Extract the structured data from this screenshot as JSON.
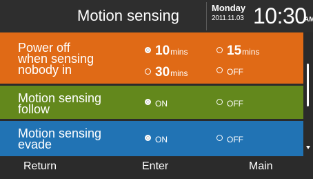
{
  "header": {
    "title": "Motion sensing",
    "day": "Monday",
    "date": "2011.11.03",
    "time": "10:30",
    "ampm": "AM"
  },
  "settings": [
    {
      "label_lines": [
        "Power off",
        "when sensing",
        "nobody in"
      ],
      "options": [
        {
          "num": "10",
          "unit": "mins",
          "selected": true
        },
        {
          "num": "15",
          "unit": "mins",
          "selected": false
        },
        {
          "num": "30",
          "unit": "mins",
          "selected": false
        },
        {
          "text": "OFF",
          "selected": false
        }
      ]
    },
    {
      "label_lines": [
        "Motion sensing",
        "follow"
      ],
      "options": [
        {
          "text": "ON",
          "selected": true
        },
        {
          "text": "OFF",
          "selected": false
        }
      ]
    },
    {
      "label_lines": [
        "Motion sensing",
        "evade"
      ],
      "options": [
        {
          "text": "ON",
          "selected": true
        },
        {
          "text": "OFF",
          "selected": false
        }
      ]
    }
  ],
  "footer": {
    "return_label": "Return",
    "enter_label": "Enter",
    "main_label": "Main"
  },
  "colors": {
    "header_bg": "#2e2e2e",
    "row_power_off": "#e06a16",
    "row_follow": "#63881c",
    "row_evade": "#2173b4",
    "footer_bg": "#2b2b2b"
  },
  "icons": {
    "radio_selected": "radio-selected-icon",
    "radio_unselected": "radio-unselected-icon",
    "scroll_down": "scroll-down-arrow-icon"
  }
}
